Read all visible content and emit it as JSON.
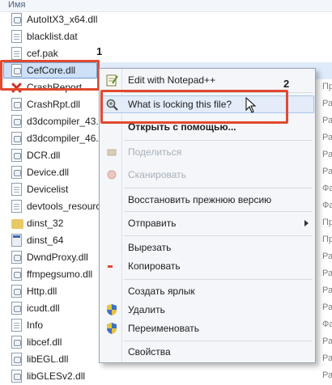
{
  "header": {
    "column_name": "Имя"
  },
  "files": [
    {
      "name": "AutoItX3_x64.dll",
      "icon": "dll",
      "meta": ""
    },
    {
      "name": "blacklist.dat",
      "icon": "gen",
      "meta": ""
    },
    {
      "name": "cef.pak",
      "icon": "gen",
      "meta": ""
    },
    {
      "name": "CefCore.dll",
      "icon": "dll",
      "meta": "",
      "selected": true
    },
    {
      "name": "CrashReport",
      "icon": "deleted",
      "meta": "Пр"
    },
    {
      "name": "CrashRpt.dll",
      "icon": "dll",
      "meta": "Ра"
    },
    {
      "name": "d3dcompiler_43.dll",
      "icon": "dll",
      "meta": "Ра"
    },
    {
      "name": "d3dcompiler_46.dll",
      "icon": "dll",
      "meta": "Ра"
    },
    {
      "name": "DCR.dll",
      "icon": "dll",
      "meta": "Ра"
    },
    {
      "name": "Device.dll",
      "icon": "dll",
      "meta": "Ра"
    },
    {
      "name": "Devicelist",
      "icon": "gen",
      "meta": "Фа"
    },
    {
      "name": "devtools_resources.pak",
      "icon": "gen",
      "meta": "Фа"
    },
    {
      "name": "dinst_32",
      "icon": "folder",
      "meta": "Пр"
    },
    {
      "name": "dinst_64",
      "icon": "exe",
      "meta": "Пр"
    },
    {
      "name": "DwndProxy.dll",
      "icon": "dll",
      "meta": "Ра"
    },
    {
      "name": "ffmpegsumo.dll",
      "icon": "dll",
      "meta": "Ра"
    },
    {
      "name": "Http.dll",
      "icon": "dll",
      "meta": "Ра"
    },
    {
      "name": "icudt.dll",
      "icon": "dll",
      "meta": "Ра"
    },
    {
      "name": "Info",
      "icon": "gen",
      "meta": "Фа"
    },
    {
      "name": "libcef.dll",
      "icon": "dll",
      "meta": "Ра"
    },
    {
      "name": "libEGL.dll",
      "icon": "dll",
      "meta": "Ра"
    },
    {
      "name": "libGLESv2.dll",
      "icon": "dll",
      "meta": "Ра"
    }
  ],
  "annotations": {
    "one": "1",
    "two": "2"
  },
  "context_menu": {
    "edit_notepad": "Edit with Notepad++",
    "locking": "What is locking this file?",
    "open_with": "Открыть с помощью...",
    "disabled_1": "Поделиться",
    "disabled_2": "Сканировать",
    "restore": "Восстановить прежнюю версию",
    "send_to": "Отправить",
    "cut": "Вырезать",
    "copy": "Копировать",
    "create_shortcut": "Создать ярлык",
    "delete": "Удалить",
    "rename": "Переименовать",
    "properties": "Свойства"
  },
  "colors": {
    "highlight": "#e2492f",
    "selection": "#cde0f7",
    "menu_bg": "#f4f6f9"
  }
}
